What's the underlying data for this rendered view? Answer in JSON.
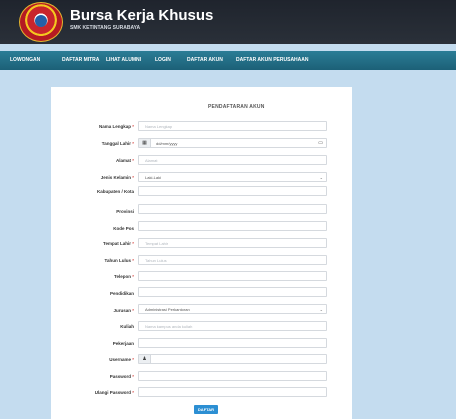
{
  "header": {
    "title": "Bursa Kerja Khusus",
    "subtitle": "SMK KETINTANG SURABAYA",
    "colors": {
      "header_bg": "#1f242d",
      "navbar_bg": "#1c6077",
      "page_bg": "#c4dcef",
      "button": "#2c8fd3"
    }
  },
  "nav": {
    "items": [
      "LOWONGAN",
      "DAFTAR MITRA",
      "LIHAT ALUMNI",
      "LOGIN",
      "DAFTAR AKUN",
      "DAFTAR AKUN PERUSAHAAN"
    ]
  },
  "form": {
    "title": "PENDAFTARAN AKUN",
    "required_mark": "*",
    "fields": [
      {
        "label": "Nama Lengkap",
        "required": true,
        "placeholder": "Nama Lengkap"
      },
      {
        "label": "Tanggal Lahir",
        "required": true,
        "value": "dd/mm/yyyy",
        "icon": "calendar-icon"
      },
      {
        "label": "Alamat",
        "required": true,
        "placeholder": "Alamat"
      },
      {
        "label": "Jenis Kelamin",
        "required": true,
        "value": "Laki-Laki"
      },
      {
        "label": "Kabupaten / Kota",
        "required": false,
        "placeholder": ""
      },
      {
        "label": "Provinsi",
        "required": false,
        "placeholder": ""
      },
      {
        "label": "Kode Pos",
        "required": false,
        "placeholder": ""
      },
      {
        "label": "Tempat Lahir",
        "required": true,
        "placeholder": "Tempat Lahir"
      },
      {
        "label": "Tahun Lulus",
        "required": true,
        "placeholder": "Tahun Lulus"
      },
      {
        "label": "Telepon",
        "required": true,
        "placeholder": ""
      },
      {
        "label": "Pendidikan",
        "required": false,
        "placeholder": ""
      },
      {
        "label": "Jurusan",
        "required": true,
        "value": "Administrasi Perkantoran"
      },
      {
        "label": "Kuliah",
        "required": false,
        "placeholder": "Nama kampus anda kuliah"
      },
      {
        "label": "Pekerjaan",
        "required": false,
        "placeholder": ""
      },
      {
        "label": "Username",
        "required": true,
        "icon": "user-icon"
      },
      {
        "label": "Password",
        "required": true,
        "placeholder": ""
      },
      {
        "label": "Ulangi Password",
        "required": true,
        "placeholder": ""
      }
    ],
    "submit_label": "DAFTAR"
  }
}
